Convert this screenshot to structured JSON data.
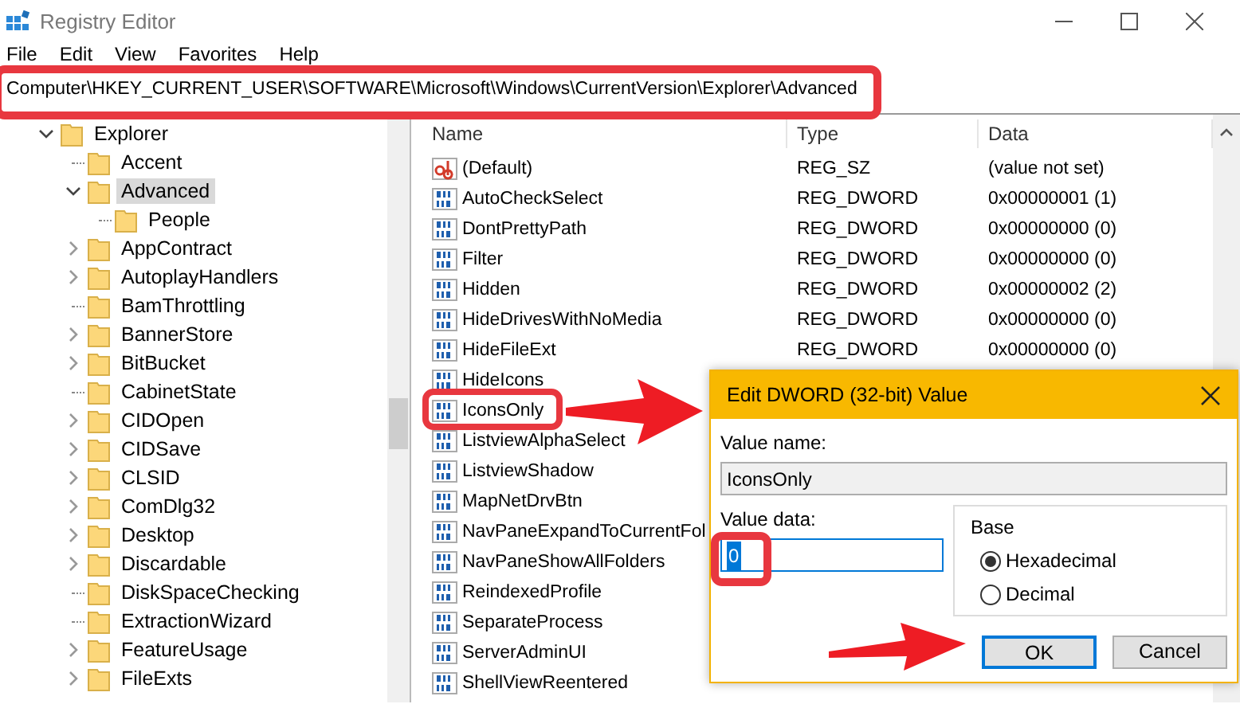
{
  "window": {
    "title": "Registry Editor"
  },
  "menu": [
    "File",
    "Edit",
    "View",
    "Favorites",
    "Help"
  ],
  "address_bar": {
    "value": "Computer\\HKEY_CURRENT_USER\\SOFTWARE\\Microsoft\\Windows\\CurrentVersion\\Explorer\\Advanced"
  },
  "tree": {
    "items": [
      {
        "label": "Explorer",
        "kind": "branch",
        "expanded": true,
        "selected": false,
        "children": [
          {
            "label": "Accent",
            "kind": "leaf",
            "selected": false
          },
          {
            "label": "Advanced",
            "kind": "branch",
            "expanded": true,
            "selected": true,
            "children": [
              {
                "label": "People",
                "kind": "leaf",
                "selected": false
              }
            ]
          },
          {
            "label": "AppContract",
            "kind": "branch",
            "expanded": false,
            "selected": false
          },
          {
            "label": "AutoplayHandlers",
            "kind": "branch",
            "expanded": false,
            "selected": false
          },
          {
            "label": "BamThrottling",
            "kind": "leaf",
            "selected": false
          },
          {
            "label": "BannerStore",
            "kind": "branch",
            "expanded": false,
            "selected": false
          },
          {
            "label": "BitBucket",
            "kind": "branch",
            "expanded": false,
            "selected": false
          },
          {
            "label": "CabinetState",
            "kind": "leaf",
            "selected": false
          },
          {
            "label": "CIDOpen",
            "kind": "branch",
            "expanded": false,
            "selected": false
          },
          {
            "label": "CIDSave",
            "kind": "branch",
            "expanded": false,
            "selected": false
          },
          {
            "label": "CLSID",
            "kind": "branch",
            "expanded": false,
            "selected": false
          },
          {
            "label": "ComDlg32",
            "kind": "branch",
            "expanded": false,
            "selected": false
          },
          {
            "label": "Desktop",
            "kind": "branch",
            "expanded": false,
            "selected": false
          },
          {
            "label": "Discardable",
            "kind": "branch",
            "expanded": false,
            "selected": false
          },
          {
            "label": "DiskSpaceChecking",
            "kind": "leaf",
            "selected": false
          },
          {
            "label": "ExtractionWizard",
            "kind": "leaf",
            "selected": false
          },
          {
            "label": "FeatureUsage",
            "kind": "branch",
            "expanded": false,
            "selected": false
          },
          {
            "label": "FileExts",
            "kind": "branch",
            "expanded": false,
            "selected": false
          }
        ]
      }
    ]
  },
  "list": {
    "columns": [
      "Name",
      "Type",
      "Data"
    ],
    "rows": [
      {
        "kind": "string",
        "name": "(Default)",
        "type": "REG_SZ",
        "data": "(value not set)"
      },
      {
        "kind": "dword",
        "name": "AutoCheckSelect",
        "type": "REG_DWORD",
        "data": "0x00000001 (1)"
      },
      {
        "kind": "dword",
        "name": "DontPrettyPath",
        "type": "REG_DWORD",
        "data": "0x00000000 (0)"
      },
      {
        "kind": "dword",
        "name": "Filter",
        "type": "REG_DWORD",
        "data": "0x00000000 (0)"
      },
      {
        "kind": "dword",
        "name": "Hidden",
        "type": "REG_DWORD",
        "data": "0x00000002 (2)"
      },
      {
        "kind": "dword",
        "name": "HideDrivesWithNoMedia",
        "type": "REG_DWORD",
        "data": "0x00000000 (0)"
      },
      {
        "kind": "dword",
        "name": "HideFileExt",
        "type": "REG_DWORD",
        "data": "0x00000000 (0)"
      },
      {
        "kind": "dword",
        "name": "HideIcons"
      },
      {
        "kind": "dword",
        "name": "IconsOnly"
      },
      {
        "kind": "dword",
        "name": "ListviewAlphaSelect"
      },
      {
        "kind": "dword",
        "name": "ListviewShadow"
      },
      {
        "kind": "dword",
        "name": "MapNetDrvBtn"
      },
      {
        "kind": "dword",
        "name": "NavPaneExpandToCurrentFol"
      },
      {
        "kind": "dword",
        "name": "NavPaneShowAllFolders"
      },
      {
        "kind": "dword",
        "name": "ReindexedProfile"
      },
      {
        "kind": "dword",
        "name": "SeparateProcess"
      },
      {
        "kind": "dword",
        "name": "ServerAdminUI"
      },
      {
        "kind": "dword",
        "name": "ShellViewReentered"
      }
    ]
  },
  "dialog": {
    "title": "Edit DWORD (32-bit) Value",
    "value_name_label": "Value name:",
    "value_name": "IconsOnly",
    "value_data_label": "Value data:",
    "value_data": "0",
    "base_label": "Base",
    "radios": [
      {
        "label": "Hexadecimal",
        "selected": true
      },
      {
        "label": "Decimal",
        "selected": false
      }
    ],
    "buttons": [
      {
        "label": "OK",
        "default": true
      },
      {
        "label": "Cancel",
        "default": false
      }
    ]
  }
}
